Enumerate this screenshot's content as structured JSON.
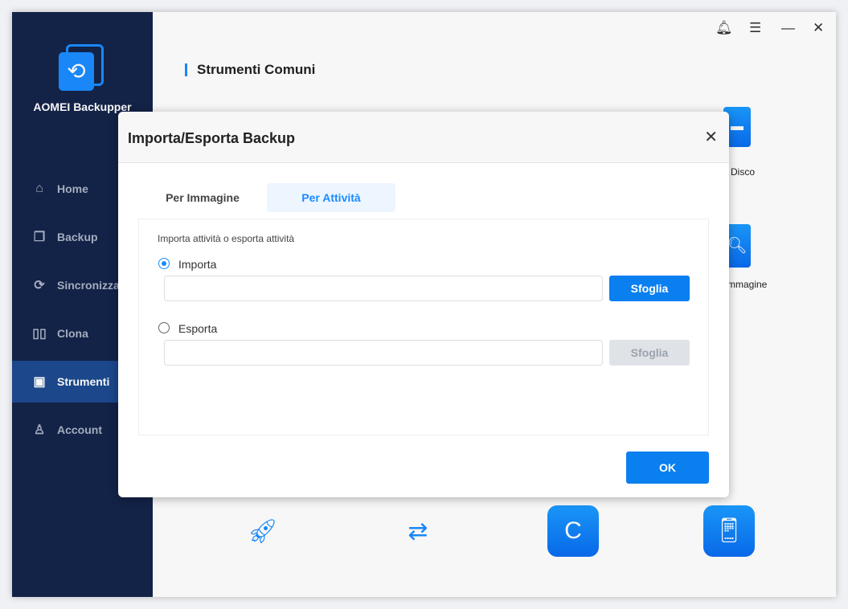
{
  "app": {
    "name": "AOMEI Backupper"
  },
  "sidebar": {
    "items": [
      {
        "label": "Home",
        "icon": "home-icon"
      },
      {
        "label": "Backup",
        "icon": "backup-icon"
      },
      {
        "label": "Sincronizza",
        "icon": "sync-icon"
      },
      {
        "label": "Clona",
        "icon": "clone-icon"
      },
      {
        "label": "Strumenti",
        "icon": "toolbox-icon",
        "active": true
      },
      {
        "label": "Account",
        "icon": "user-icon"
      }
    ]
  },
  "main": {
    "title": "Strumenti Comuni",
    "partial_labels": [
      "Disco",
      "mmagine"
    ]
  },
  "dialog": {
    "title": "Importa/Esporta Backup",
    "tabs": [
      "Per Immagine",
      "Per Attività"
    ],
    "active_tab": "Per Attività",
    "hint": "Importa attività o esporta attività",
    "import": {
      "label": "Importa",
      "selected": true,
      "value": "",
      "browse": "Sfoglia"
    },
    "export": {
      "label": "Esporta",
      "selected": false,
      "value": "",
      "browse": "Sfoglia"
    },
    "ok": "OK"
  },
  "colors": {
    "accent": "#0a7ff0",
    "sidebar": "#14244a"
  }
}
